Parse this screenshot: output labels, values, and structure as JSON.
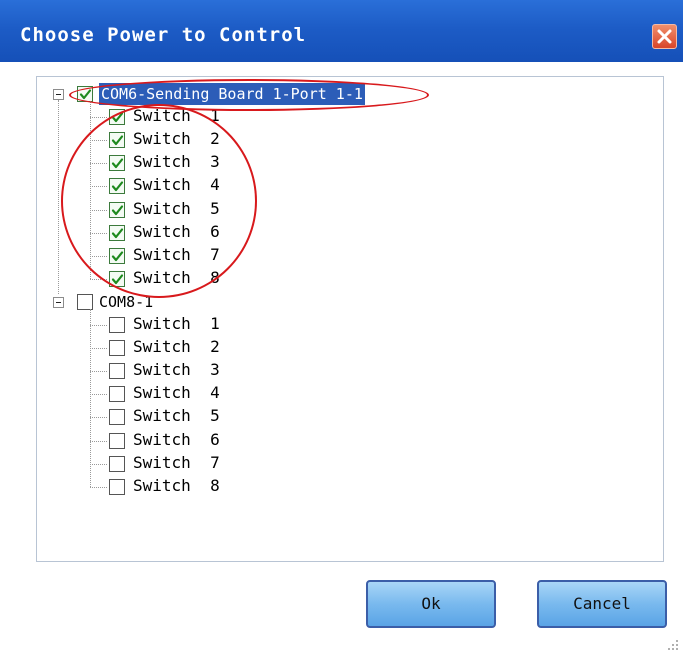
{
  "dialog": {
    "title": "Choose Power to Control",
    "ok_label": "Ok",
    "cancel_label": "Cancel"
  },
  "tree": {
    "groups": [
      {
        "label": "COM6-Sending Board 1-Port 1-1",
        "checked": true,
        "selected": true,
        "switches": [
          {
            "label": "Switch  1",
            "checked": true
          },
          {
            "label": "Switch  2",
            "checked": true
          },
          {
            "label": "Switch  3",
            "checked": true
          },
          {
            "label": "Switch  4",
            "checked": true
          },
          {
            "label": "Switch  5",
            "checked": true
          },
          {
            "label": "Switch  6",
            "checked": true
          },
          {
            "label": "Switch  7",
            "checked": true
          },
          {
            "label": "Switch  8",
            "checked": true
          }
        ]
      },
      {
        "label": "COM8-1",
        "checked": false,
        "selected": false,
        "switches": [
          {
            "label": "Switch  1",
            "checked": false
          },
          {
            "label": "Switch  2",
            "checked": false
          },
          {
            "label": "Switch  3",
            "checked": false
          },
          {
            "label": "Switch  4",
            "checked": false
          },
          {
            "label": "Switch  5",
            "checked": false
          },
          {
            "label": "Switch  6",
            "checked": false
          },
          {
            "label": "Switch  7",
            "checked": false
          },
          {
            "label": "Switch  8",
            "checked": false
          }
        ]
      }
    ]
  },
  "colors": {
    "title_bar": "#1d5cc6",
    "selection": "#2c5db8",
    "annotation": "#d8191c",
    "button": "#79b9ee"
  },
  "icons": {
    "close": "close-icon",
    "expand": "minus-expander-icon",
    "check": "checkmark-icon",
    "grip": "resize-grip-icon"
  }
}
